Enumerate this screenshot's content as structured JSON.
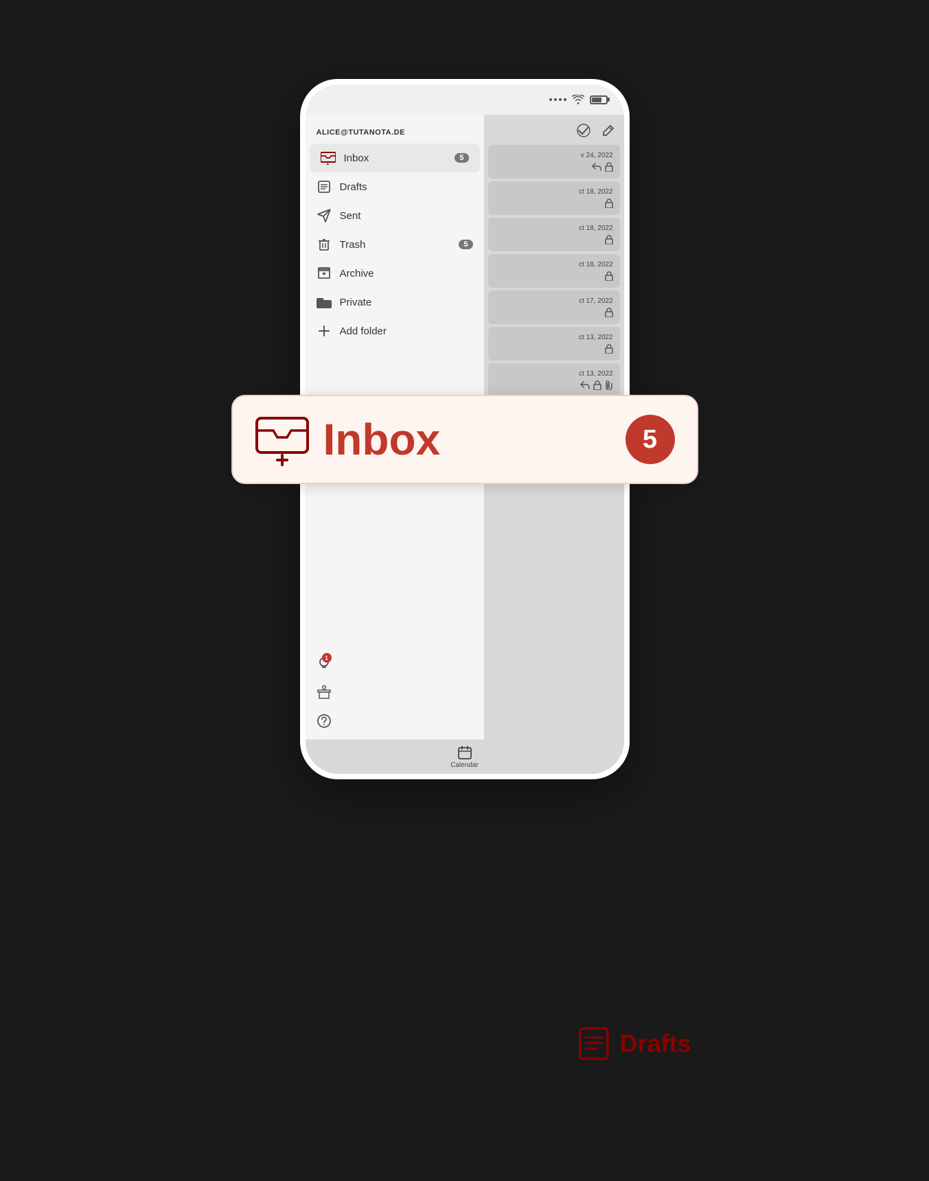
{
  "scene": {
    "background": "#1a1a1a"
  },
  "status_bar": {
    "wifi": "wifi-icon",
    "battery": "battery-icon"
  },
  "sidebar": {
    "account": "ALICE@TUTANOTA.DE",
    "items": [
      {
        "id": "inbox",
        "label": "Inbox",
        "badge": "5",
        "active": true
      },
      {
        "id": "drafts",
        "label": "Drafts",
        "badge": null,
        "active": false
      },
      {
        "id": "sent",
        "label": "Sent",
        "badge": null,
        "active": false
      },
      {
        "id": "trash",
        "label": "Trash",
        "badge": "5",
        "active": false
      },
      {
        "id": "archive",
        "label": "Archive",
        "badge": null,
        "active": false
      },
      {
        "id": "private",
        "label": "Private",
        "badge": null,
        "active": false
      }
    ],
    "add_folder": "Add folder",
    "bottom_icons": [
      {
        "id": "tips",
        "notification": "1"
      },
      {
        "id": "gift"
      },
      {
        "id": "help"
      },
      {
        "id": "settings"
      }
    ]
  },
  "email_list": {
    "items": [
      {
        "date": "v 24, 2022",
        "icons": [
          "reply",
          "lock"
        ]
      },
      {
        "date": "ct 18, 2022",
        "icons": [
          "lock"
        ]
      },
      {
        "date": "ct 18, 2022",
        "icons": [
          "lock"
        ]
      },
      {
        "date": "ct 18, 2022",
        "icons": [
          "lock"
        ]
      },
      {
        "date": "ct 17, 2022",
        "icons": [
          "lock"
        ]
      },
      {
        "date": "ct 13, 2022",
        "icons": [
          "lock"
        ]
      },
      {
        "date": "ct 13, 2022",
        "icons": [
          "reply",
          "lock",
          "attachment"
        ]
      }
    ]
  },
  "bottom_tab": {
    "label": "Calendar"
  },
  "inbox_highlight": {
    "label": "Inbox",
    "badge": "5"
  },
  "drafts_label": {
    "label": "Drafts"
  }
}
